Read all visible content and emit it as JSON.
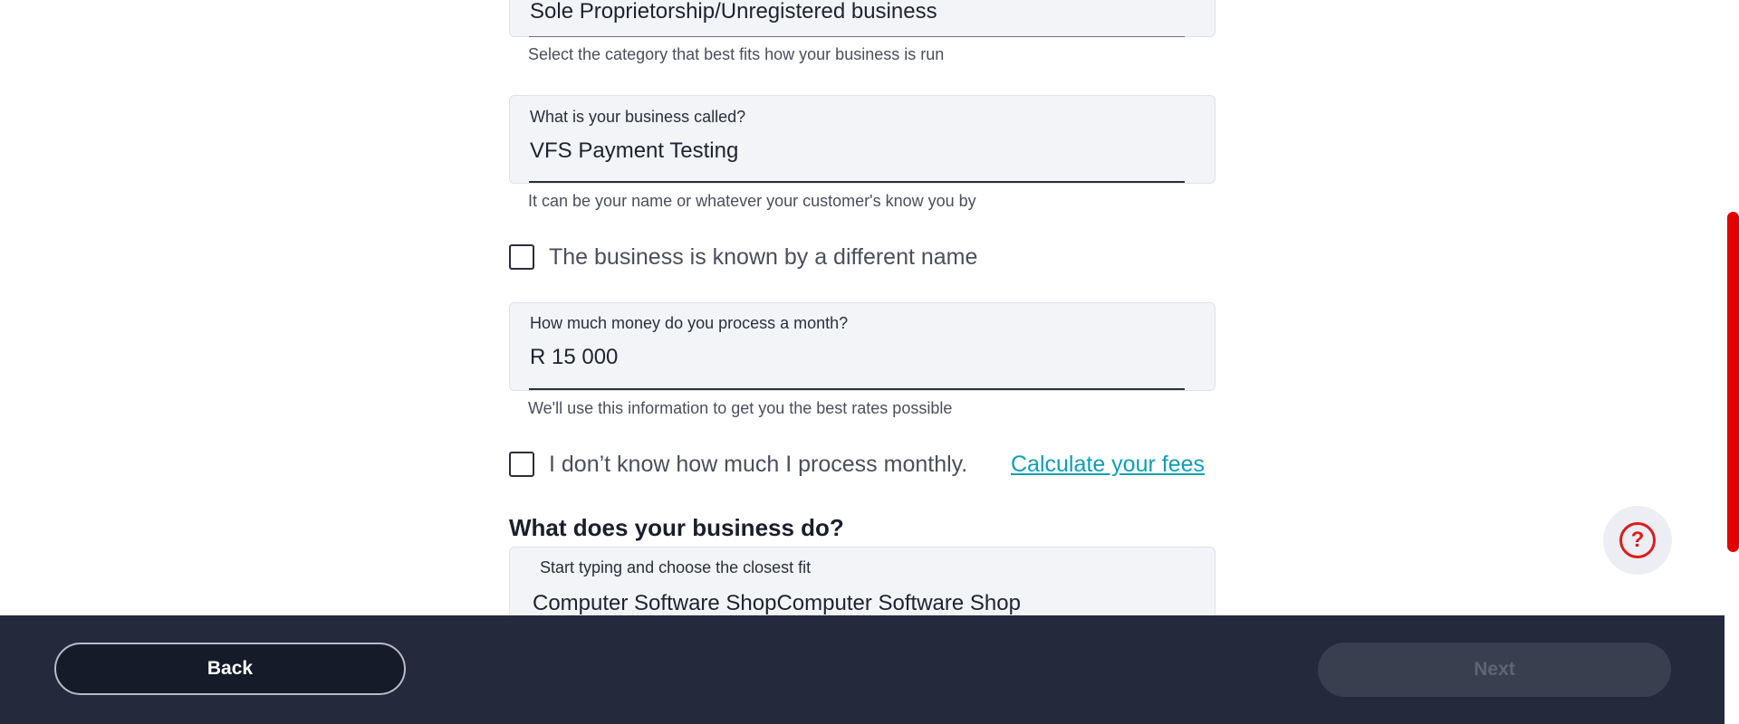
{
  "form": {
    "business_type": {
      "value": "Sole Proprietorship/Unregistered business",
      "helper": "Select the category that best fits how your business is run"
    },
    "business_name": {
      "label": "What is your business called?",
      "value": "VFS Payment Testing",
      "helper": "It can be your name or whatever your customer's know you by"
    },
    "different_name_checkbox": {
      "label": "The business is known by a different name",
      "checked": false
    },
    "monthly_volume": {
      "label": "How much money do you process a month?",
      "value": "R 15 000",
      "helper": "We'll use this information to get you the best rates possible"
    },
    "unknown_volume_checkbox": {
      "label": "I don’t know how much I process monthly.",
      "checked": false
    },
    "calculate_fees_link": "Calculate your fees",
    "business_activity": {
      "section_title": "What does your business do?",
      "label": "Start typing and choose the closest fit",
      "value_part1": "Computer Software ",
      "value_misspelled": "ShopComputer",
      "value_part2": " Software Shop"
    }
  },
  "help_button": {
    "icon": "question-circle-icon",
    "glyph": "?"
  },
  "footer": {
    "back_label": "Back",
    "next_label": "Next"
  },
  "colors": {
    "accent_red": "#e01b1b",
    "link_teal": "#0e9fb5",
    "footer_bg": "#242a3c"
  }
}
